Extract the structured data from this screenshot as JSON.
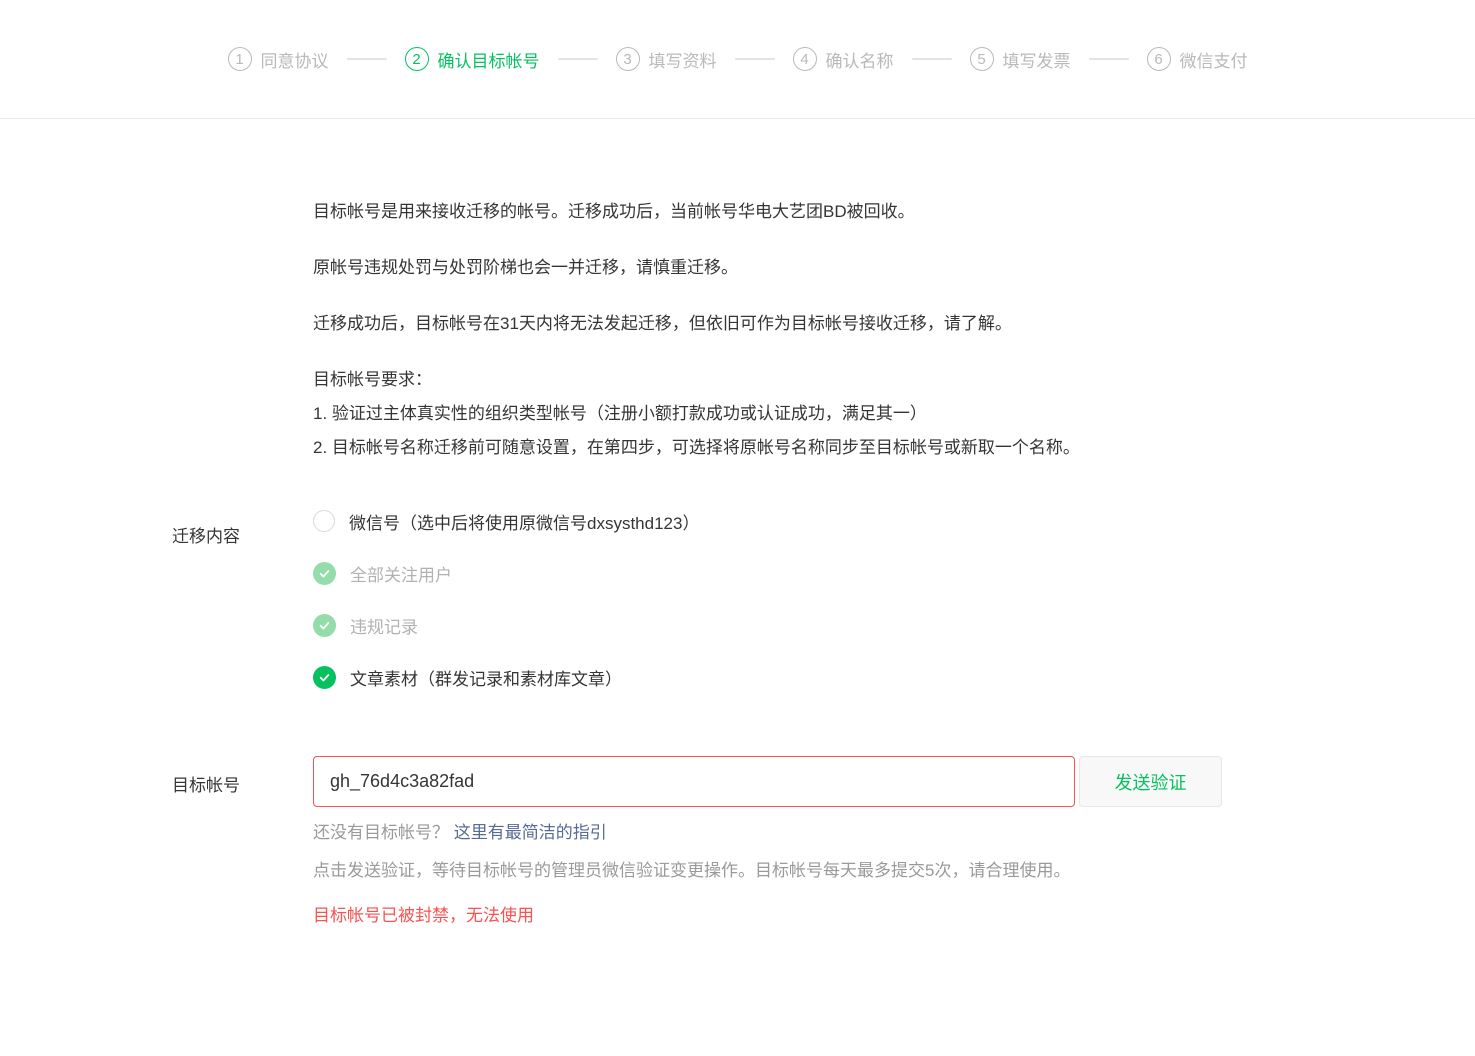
{
  "stepper": {
    "active_step": "2",
    "steps": [
      {
        "num": "1",
        "label": "同意协议"
      },
      {
        "num": "2",
        "label": "确认目标帐号"
      },
      {
        "num": "3",
        "label": "填写资料"
      },
      {
        "num": "4",
        "label": "确认名称"
      },
      {
        "num": "5",
        "label": "填写发票"
      },
      {
        "num": "6",
        "label": "微信支付"
      }
    ]
  },
  "intro": {
    "p1": "目标帐号是用来接收迁移的帐号。迁移成功后，当前帐号华电大艺团BD被回收。",
    "p2": "原帐号违规处罚与处罚阶梯也会一并迁移，请慎重迁移。",
    "p3": "迁移成功后，目标帐号在31天内将无法发起迁移，但依旧可作为目标帐号接收迁移，请了解。",
    "req_title": "目标帐号要求：",
    "req_1": "1. 验证过主体真实性的组织类型帐号（注册小额打款成功或认证成功，满足其一）",
    "req_2": "2. 目标帐号名称迁移前可随意设置，在第四步，可选择将原帐号名称同步至目标帐号或新取一个名称。"
  },
  "migration": {
    "label": "迁移内容",
    "items": [
      {
        "label": "微信号（选中后将使用原微信号dxsysthd123）",
        "state": "unchecked"
      },
      {
        "label": "全部关注用户",
        "state": "checked_disabled"
      },
      {
        "label": "违规记录",
        "state": "checked_disabled"
      },
      {
        "label": "文章素材（群发记录和素材库文章）",
        "state": "checked"
      }
    ]
  },
  "target": {
    "label": "目标帐号",
    "input_value": "gh_76d4c3a82fad",
    "send_button_label": "发送验证",
    "hint_question": "还没有目标帐号？",
    "hint_link": "这里有最简洁的指引",
    "hint_note": "点击发送验证，等待目标帐号的管理员微信验证变更操作。目标帐号每天最多提交5次，请合理使用。",
    "error_message": "目标帐号已被封禁，无法使用"
  },
  "colors": {
    "active_green": "#07c160",
    "disabled_green": "#95dcab",
    "link_blue": "#576b95",
    "error_red": "#fa5151",
    "inactive_gray": "#b9b9b9"
  }
}
